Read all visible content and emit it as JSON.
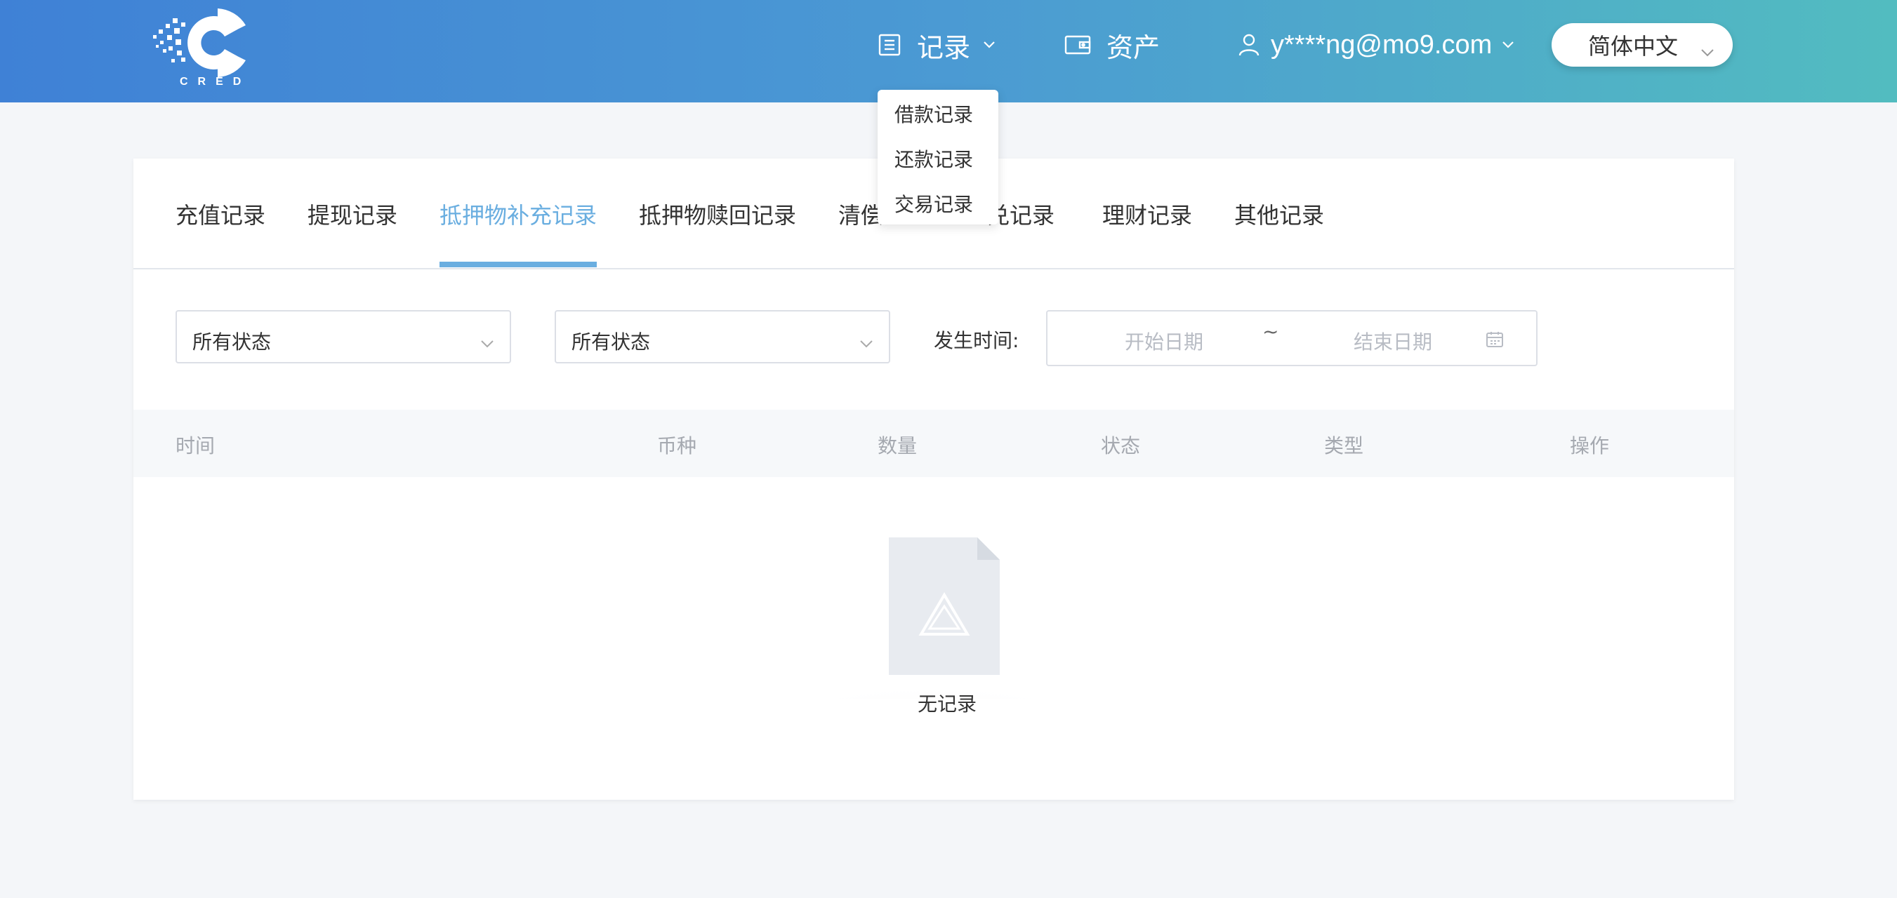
{
  "header": {
    "logo_text": "CRED",
    "nav_records": "记录",
    "nav_assets": "资产",
    "user_email": "y****ng@mo9.com",
    "language": "简体中文"
  },
  "records_menu": {
    "items": [
      "借款记录",
      "还款记录",
      "交易记录"
    ]
  },
  "tabs": [
    {
      "label": "充值记录",
      "active": false
    },
    {
      "label": "提现记录",
      "active": false
    },
    {
      "label": "抵押物补充记录",
      "active": true
    },
    {
      "label": "抵押物赎回记录",
      "active": false
    },
    {
      "label": "清偿",
      "active": false
    },
    {
      "label": "兑记录",
      "active": false
    },
    {
      "label": "理财记录",
      "active": false
    },
    {
      "label": "其他记录",
      "active": false
    }
  ],
  "filters": {
    "select1": "所有状态",
    "select2": "所有状态",
    "time_label": "发生时间:",
    "start_placeholder": "开始日期",
    "range_separator": "~",
    "end_placeholder": "结束日期"
  },
  "table": {
    "columns": [
      "时间",
      "币种",
      "数量",
      "状态",
      "类型",
      "操作"
    ]
  },
  "empty": {
    "text": "无记录"
  },
  "colors": {
    "header_gradient_start": "#3f81d6",
    "header_gradient_end": "#52bcc0",
    "active_tab": "#6aaee0"
  }
}
